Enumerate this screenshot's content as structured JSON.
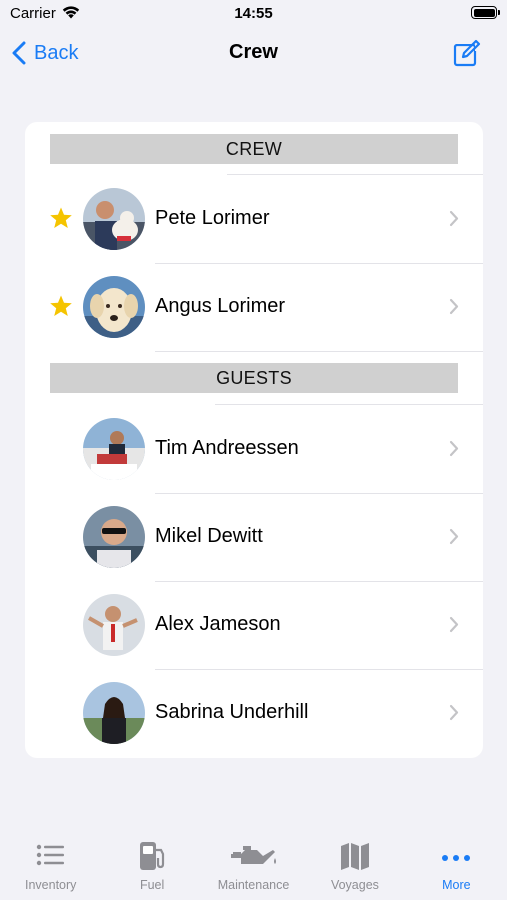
{
  "status_bar": {
    "carrier": "Carrier",
    "time": "14:55"
  },
  "nav": {
    "back_label": "Back",
    "title": "Crew"
  },
  "sections": {
    "crew": {
      "header": "CREW",
      "members": [
        {
          "name": "Pete Lorimer",
          "starred": true
        },
        {
          "name": "Angus Lorimer",
          "starred": true
        }
      ]
    },
    "guests": {
      "header": "GUESTS",
      "members": [
        {
          "name": "Tim Andreessen",
          "starred": false
        },
        {
          "name": "Mikel Dewitt",
          "starred": false
        },
        {
          "name": "Alex Jameson",
          "starred": false
        },
        {
          "name": "Sabrina Underhill",
          "starred": false
        }
      ]
    }
  },
  "tabs": [
    {
      "label": "Inventory",
      "icon": "list-icon",
      "active": false
    },
    {
      "label": "Fuel",
      "icon": "fuel-pump-icon",
      "active": false
    },
    {
      "label": "Maintenance",
      "icon": "oil-can-icon",
      "active": false
    },
    {
      "label": "Voyages",
      "icon": "map-icon",
      "active": false
    },
    {
      "label": "More",
      "icon": "ellipsis-icon",
      "active": true
    }
  ],
  "colors": {
    "accent": "#1a7cf5",
    "star": "#f5c400",
    "inactive": "#8e8e93",
    "section_header_bg": "#d0d0d0",
    "background": "#f2f2f7"
  }
}
